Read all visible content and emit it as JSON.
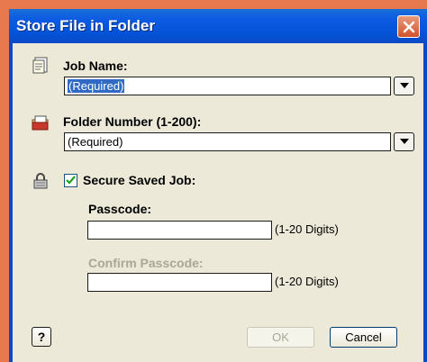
{
  "window": {
    "title": "Store File in Folder"
  },
  "job_name": {
    "label": "Job Name:",
    "value": "(Required)"
  },
  "folder_number": {
    "label": "Folder Number (1-200):",
    "value": "(Required)"
  },
  "secure": {
    "label": "Secure Saved Job:",
    "checked": true
  },
  "passcode": {
    "label": "Passcode:",
    "value": "",
    "hint": "(1-20 Digits)"
  },
  "confirm_passcode": {
    "label": "Confirm Passcode:",
    "value": "",
    "hint": "(1-20 Digits)"
  },
  "buttons": {
    "help": "?",
    "ok": "OK",
    "cancel": "Cancel"
  },
  "icons": {
    "close": "close-icon",
    "job": "document-icon",
    "folder": "folder-icon",
    "lock": "lock-icon",
    "check": "check-icon",
    "dropdown": "chevron-down-icon"
  }
}
